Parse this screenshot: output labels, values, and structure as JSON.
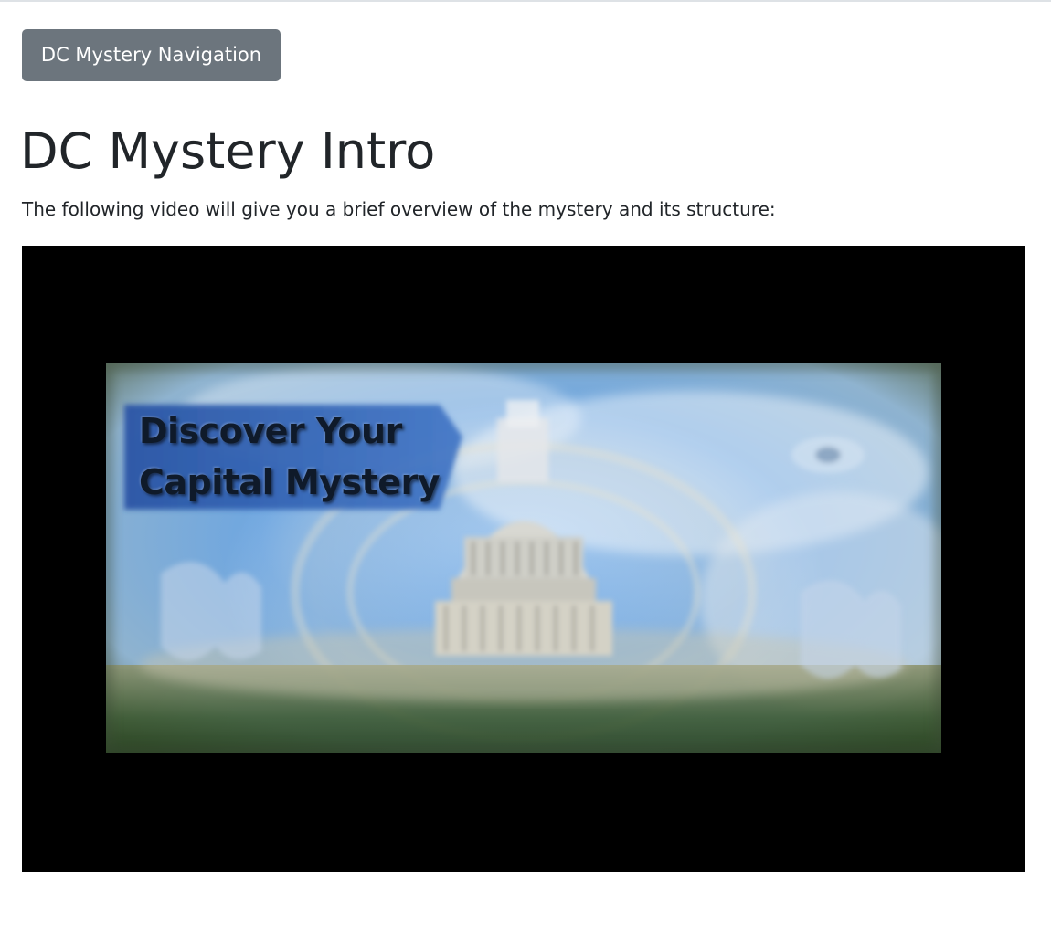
{
  "navigation": {
    "button_label": "DC Mystery Navigation"
  },
  "header": {
    "title": "DC Mystery Intro"
  },
  "intro": {
    "text": "The following video will give you a brief overview of the mystery and its structure:"
  },
  "video": {
    "poster_title_line1": "Discover Your",
    "poster_title_line2": "Capital Mystery",
    "poster_subject": "capitol-dome-image"
  },
  "colors": {
    "button_bg": "#6c757d",
    "button_text": "#ffffff",
    "text": "#212529",
    "video_bg": "#000000",
    "banner_blue": "#2f5fb0",
    "sky_blue": "#6ea6e0"
  }
}
